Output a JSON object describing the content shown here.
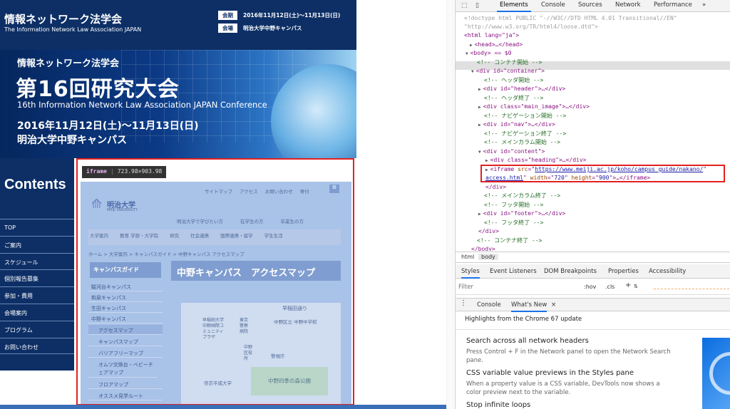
{
  "site": {
    "header_title": "情報ネットワーク法学会",
    "header_subtitle": "The Information Network Law Association JAPAN",
    "info": [
      {
        "label": "会期",
        "value": "2016年11月12日(土)～11月13日(日)"
      },
      {
        "label": "会場",
        "value": "明治大学中野キャンパス"
      }
    ],
    "hero": {
      "sub": "情報ネットワーク法学会",
      "title": "第16回研究大会",
      "english": "16th Information Network Law Association JAPAN Conference",
      "date": "2016年11月12日(土)～11月13日(日)",
      "venue": "明治大学中野キャンパス"
    },
    "contents_heading": "Contents",
    "nav": [
      "TOP",
      "ご案内",
      "スケジュール",
      "個別報告募集",
      "参加・費用",
      "会場案内",
      "プログラム",
      "お問い合わせ"
    ],
    "tooltip": {
      "tag": "iframe",
      "size": "723.98×903.98"
    },
    "iframe": {
      "top_links": [
        "サイトマップ",
        "アクセス",
        "お問い合わせ",
        "寄付"
      ],
      "logo": "明治大学",
      "logo_sub": "MEIJI UNIVERSITY",
      "cat_tabs": [
        "明治大学で学びたい方",
        "在学生の方",
        "卒業生の方"
      ],
      "nav": [
        "大学案内",
        "教育 学部・大学院",
        "研究",
        "社会連携",
        "国際連携・留学",
        "学生生活"
      ],
      "breadcrumb": "ホーム > 大学案内 > キャンパスガイド > 中野キャンパス アクセスマップ",
      "side_title": "キャンパスガイド",
      "page_title": "中野キャンパス　アクセスマップ",
      "side_items": [
        "駿河台キャンパス",
        "和泉キャンパス",
        "生田キャンパス",
        "中野キャンパス",
        "アクセスマップ",
        "キャンパスマップ",
        "バリアフリーマップ",
        "オムツ交換台・ベビーチェアマップ",
        "フロアマップ",
        "オススメ見学ルート"
      ],
      "map_labels": [
        "早稲田通り",
        "早稲田大学中野国際コミュニティプラザ",
        "東京警察病院",
        "中野区立 中野中学校",
        "中野区役所",
        "警視庁",
        "帝京平成大学",
        "中野四季の森公園"
      ]
    }
  },
  "devtools": {
    "tabs": [
      "Elements",
      "Console",
      "Sources",
      "Network",
      "Performance"
    ],
    "more": "»",
    "code": {
      "doctype": "<!doctype html PUBLIC \"-//W3C//DTD HTML 4.01 Transitional//EN\"",
      "doctype2": "\"http://www.w3.org/TR/html4/loose.dtd\">",
      "html_open": "<html lang=\"ja\">",
      "head": "<head>…</head>",
      "body_sel": "<body> == $0",
      "c1": "<!-- コンテナ開始 -->",
      "container": "<div id=\"container\">",
      "c2": "<!-- ヘッダ開始 -->",
      "header": "<div id=\"header\">…</div>",
      "c3": "<!-- ヘッダ終了 -->",
      "main_image": "<div class=\"main_image\">…</div>",
      "c4": "<!-- ナビゲーション開始 -->",
      "nav": "<div id=\"nav\">…</div>",
      "c5": "<!-- ナビゲーション終了 -->",
      "c6": "<!-- メインカラム開始 -->",
      "content": "<div id=\"content\">",
      "heading": "<div class=\"heading\">…</div>",
      "iframe_src": "https://www.meiji.ac.jp/koho/campus_guide/nakano/",
      "iframe_src2": "access.html",
      "iframe_width": "720",
      "iframe_height": "900",
      "div_close": "</div>",
      "c7": "<!-- メインカラム終了 -->",
      "c8": "<!-- フッタ開始 -->",
      "footer": "<div id=\"footer\">…</div>",
      "c9": "<!-- フッタ終了 -->",
      "div_close2": "</div>",
      "c10": "<!-- コンテナ終了 -->",
      "body_close": "</body>"
    },
    "crumbs": [
      "html",
      "body"
    ],
    "styles_tabs": [
      "Styles",
      "Event Listeners",
      "DOM Breakpoints",
      "Properties",
      "Accessibility"
    ],
    "filter_placeholder": "Filter",
    "filter_hov": ":hov",
    "filter_cls": ".cls",
    "drawer_tabs": [
      "Console",
      "What's New"
    ],
    "highlights": "Highlights from the Chrome 67 update",
    "news": [
      {
        "title": "Search across all network headers",
        "body": "Press Control + F in the Network panel to open the Network Search pane."
      },
      {
        "title": "CSS variable value previews in the Styles pane",
        "body": "When a property value is a CSS variable, DevTools now shows a color preview next to the variable."
      },
      {
        "title": "Stop infinite loops",
        "body": ""
      }
    ]
  }
}
